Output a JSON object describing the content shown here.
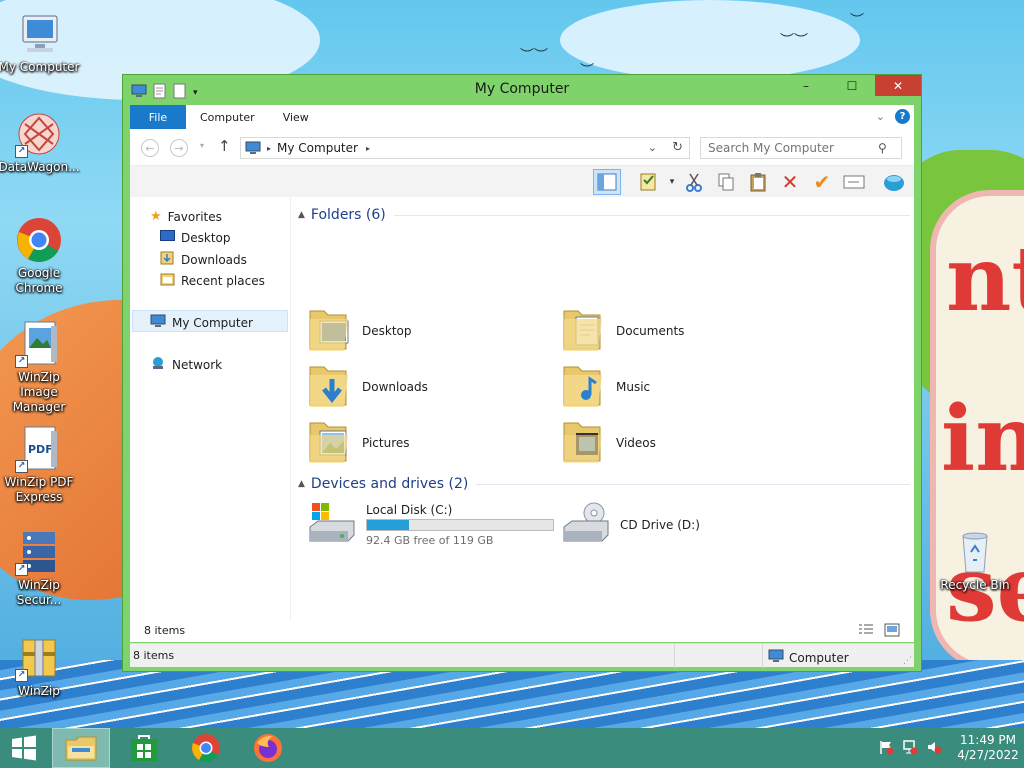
{
  "desktop": {
    "icons": [
      {
        "label": "My Computer"
      },
      {
        "label": "DataWagon..."
      },
      {
        "label": "Google Chrome"
      },
      {
        "label": "WinZip Image Manager"
      },
      {
        "label": "WinZip PDF Express"
      },
      {
        "label": "WinZip Secur..."
      },
      {
        "label": "WinZip"
      },
      {
        "label": "Recycle Bin"
      }
    ]
  },
  "window": {
    "title": "My Computer",
    "controls": {
      "minimize": "–",
      "maximize": "☐",
      "close": "✕"
    },
    "ribbon_tabs": [
      "File",
      "Computer",
      "View"
    ],
    "address": {
      "location": "My Computer"
    },
    "search": {
      "placeholder": "Search My Computer"
    },
    "nav_pane": {
      "favorites": "Favorites",
      "favorite_items": [
        "Desktop",
        "Downloads",
        "Recent places"
      ],
      "this_pc": "My Computer",
      "network": "Network"
    },
    "folders_group": "Folders (6)",
    "folders": [
      {
        "name": "Desktop",
        "icon": "desktop-folder-icon"
      },
      {
        "name": "Documents",
        "icon": "documents-folder-icon"
      },
      {
        "name": "Downloads",
        "icon": "downloads-folder-icon"
      },
      {
        "name": "Music",
        "icon": "music-folder-icon"
      },
      {
        "name": "Pictures",
        "icon": "pictures-folder-icon"
      },
      {
        "name": "Videos",
        "icon": "videos-folder-icon"
      }
    ],
    "drives_group": "Devices and drives (2)",
    "drives": [
      {
        "name": "Local Disk (C:)",
        "free_text": "92.4 GB free of 119 GB",
        "used_fraction": 0.224
      },
      {
        "name": "CD Drive (D:)"
      }
    ],
    "item_count": "8 items",
    "status": {
      "count": "8 items",
      "location": "Computer"
    }
  },
  "taskbar": {
    "time": "11:49 PM",
    "date": "4/27/2022"
  },
  "colors": {
    "window_frame": "#7ed46a",
    "accent": "#1979ca",
    "taskbar": "#3a8d7c",
    "close": "#c84031"
  }
}
